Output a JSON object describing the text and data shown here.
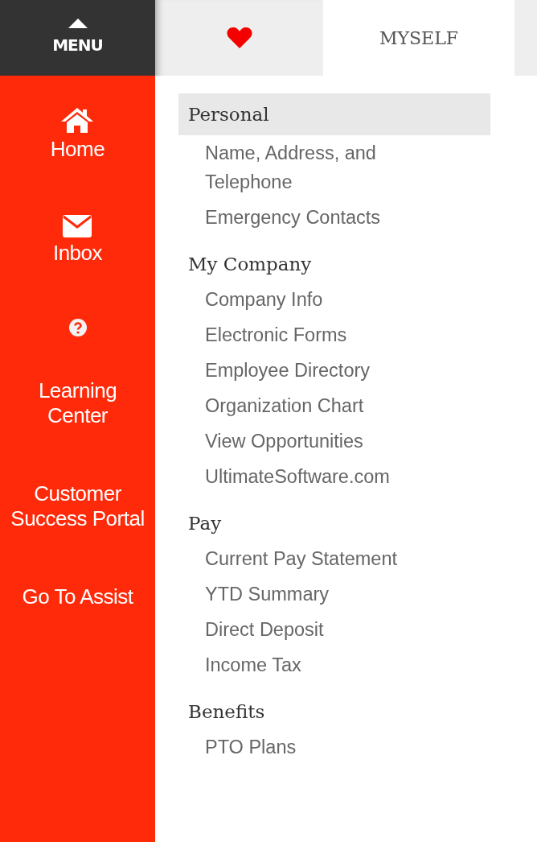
{
  "menu": {
    "label": "MENU"
  },
  "sidebar": {
    "items": [
      {
        "kind": "home",
        "label": "Home"
      },
      {
        "kind": "mail",
        "label": "Inbox"
      },
      {
        "kind": "help",
        "label": "Learning Center"
      },
      {
        "kind": "text",
        "label": "Customer Success Portal"
      },
      {
        "kind": "text",
        "label": "Go To Assist"
      }
    ]
  },
  "tabs": [
    {
      "kind": "heart",
      "selected": false
    },
    {
      "kind": "text",
      "label": "MYSELF",
      "selected": true
    },
    {
      "kind": "blank",
      "selected": false
    }
  ],
  "sections": [
    {
      "title": "Personal",
      "selected": true,
      "items": [
        "Name, Address, and Telephone",
        "Emergency Contacts"
      ]
    },
    {
      "title": "My Company",
      "selected": false,
      "items": [
        "Company Info",
        "Electronic Forms",
        "Employee Directory",
        "Organization Chart",
        "View Opportunities",
        "UltimateSoftware.com"
      ]
    },
    {
      "title": "Pay",
      "selected": false,
      "items": [
        "Current Pay Statement",
        "YTD Summary",
        "Direct Deposit",
        "Income Tax"
      ]
    },
    {
      "title": "Benefits",
      "selected": false,
      "items": [
        "PTO Plans"
      ]
    }
  ]
}
